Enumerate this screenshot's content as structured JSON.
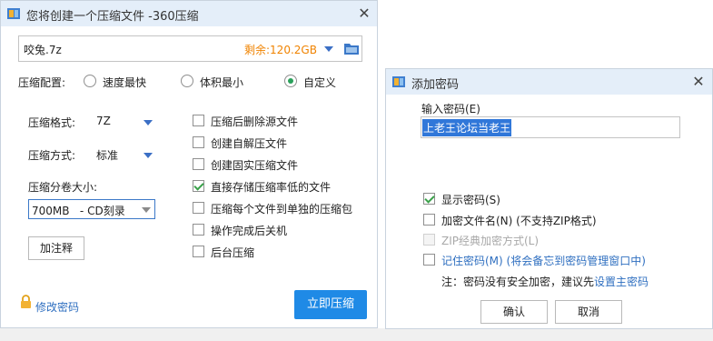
{
  "compress_dialog": {
    "title": "您将创建一个压缩文件 -360压缩",
    "file_name": "咬兔.7z",
    "free_space": "剩余:120.2GB",
    "config_label": "压缩配置:",
    "radio_fastest": "速度最快",
    "radio_smallest": "体积最小",
    "radio_custom": "自定义",
    "format_label": "压缩格式:",
    "format_value": "7Z",
    "method_label": "压缩方式:",
    "method_value": "标准",
    "volume_label": "压缩分卷大小:",
    "volume_value": "700MB   - CD刻录",
    "options": [
      {
        "label": "压缩后删除源文件",
        "checked": false
      },
      {
        "label": "创建自解压文件",
        "checked": false
      },
      {
        "label": "创建固实压缩文件",
        "checked": false
      },
      {
        "label": "直接存储压缩率低的文件",
        "checked": true
      },
      {
        "label": "压缩每个文件到单独的压缩包",
        "checked": false
      },
      {
        "label": "操作完成后关机",
        "checked": false
      },
      {
        "label": "后台压缩",
        "checked": false
      }
    ],
    "comment_button": "加注释",
    "change_password": "修改密码",
    "compress_button": "立即压缩"
  },
  "password_dialog": {
    "title": "添加密码",
    "input_label": "输入密码(E)",
    "password_value": "上老王论坛当老王",
    "show_password": "显示密码(S)",
    "encrypt_filenames": "加密文件名(N) (不支持ZIP格式)",
    "zip_classic": "ZIP经典加密方式(L)",
    "remember_password": "记住密码(M) (将会备忘到密码管理窗口中)",
    "note_prefix": "注：密码没有安全加密，建议先",
    "note_link": "设置主密码",
    "ok_button": "确认",
    "cancel_button": "取消"
  },
  "colors": {
    "accent": "#1f8ae6",
    "link": "#2f6fc0",
    "orange": "#f08300",
    "selection": "#3077d9"
  }
}
